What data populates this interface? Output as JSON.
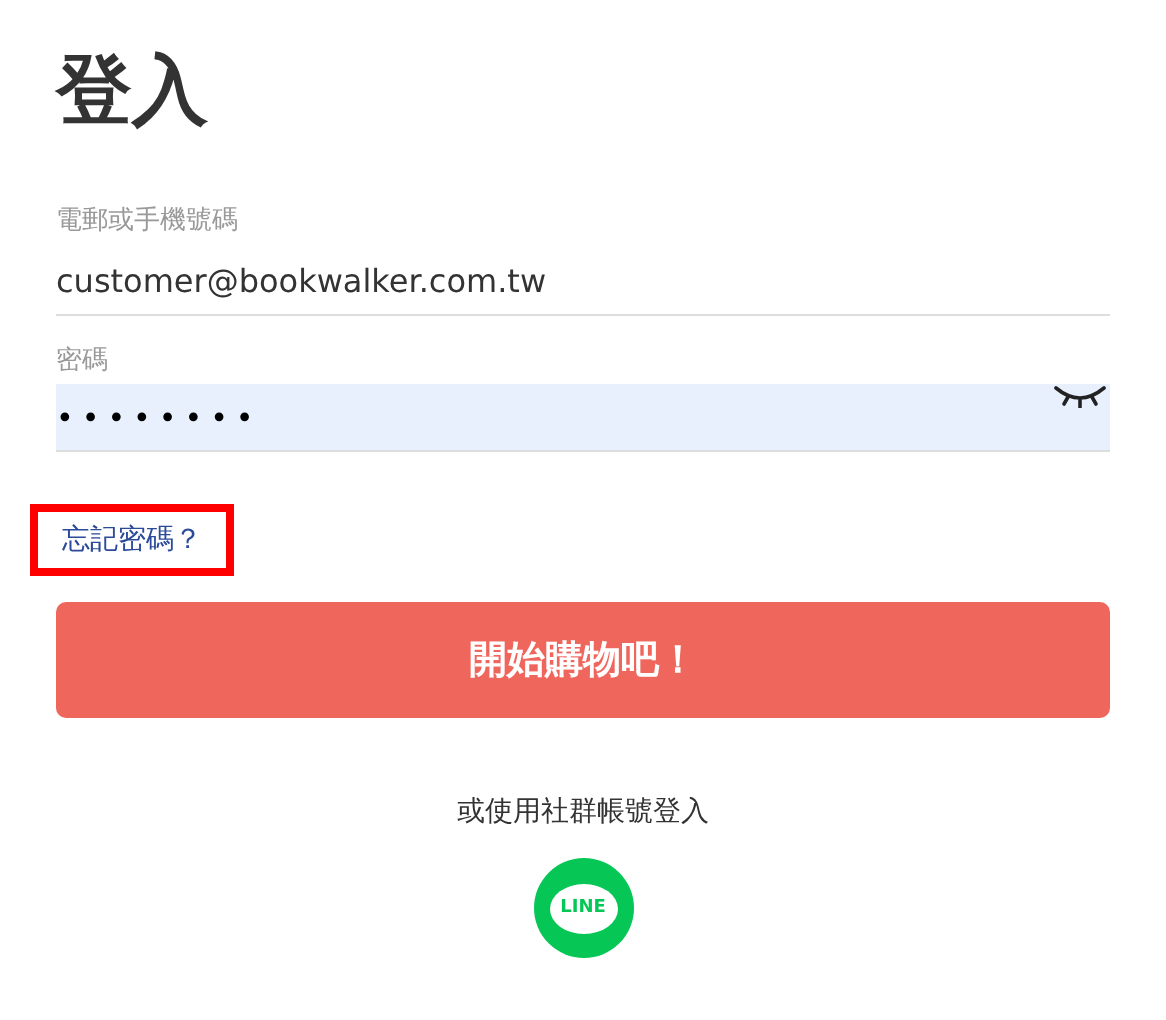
{
  "title": "登入",
  "fields": [
    {
      "kind": "text",
      "label": "電郵或手機號碼",
      "value": "customer@bookwalker.com.tw",
      "autofilled": false
    },
    {
      "kind": "password",
      "label": "密碼",
      "value": "••••••••",
      "autofilled": true
    }
  ],
  "forgot_link": {
    "label": "忘記密碼？",
    "highlighted": true
  },
  "submit_button": {
    "label": "開始購物吧！"
  },
  "social_login": {
    "label": "或使用社群帳號登入",
    "providers": [
      {
        "label": "LINE",
        "color": "#06c755"
      }
    ]
  }
}
